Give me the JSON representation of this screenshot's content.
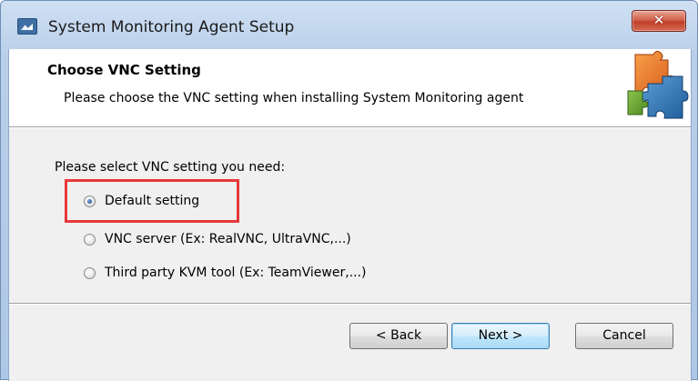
{
  "window": {
    "title": "System Monitoring Agent Setup",
    "close_glyph": "✕"
  },
  "header": {
    "title": "Choose VNC Setting",
    "subtitle": "Please choose the VNC setting when installing System Monitoring agent",
    "logo_icon": "puzzle-pieces-icon"
  },
  "body": {
    "prompt": "Please select VNC setting you need:",
    "options": [
      {
        "label": "Default setting",
        "selected": true
      },
      {
        "label": "VNC server (Ex: RealVNC, UltraVNC,...)",
        "selected": false
      },
      {
        "label": "Third party KVM tool (Ex: TeamViewer,...)",
        "selected": false
      }
    ],
    "highlight_color": "#e8383b"
  },
  "buttons": {
    "back": "< Back",
    "next": "Next >",
    "cancel": "Cancel"
  }
}
